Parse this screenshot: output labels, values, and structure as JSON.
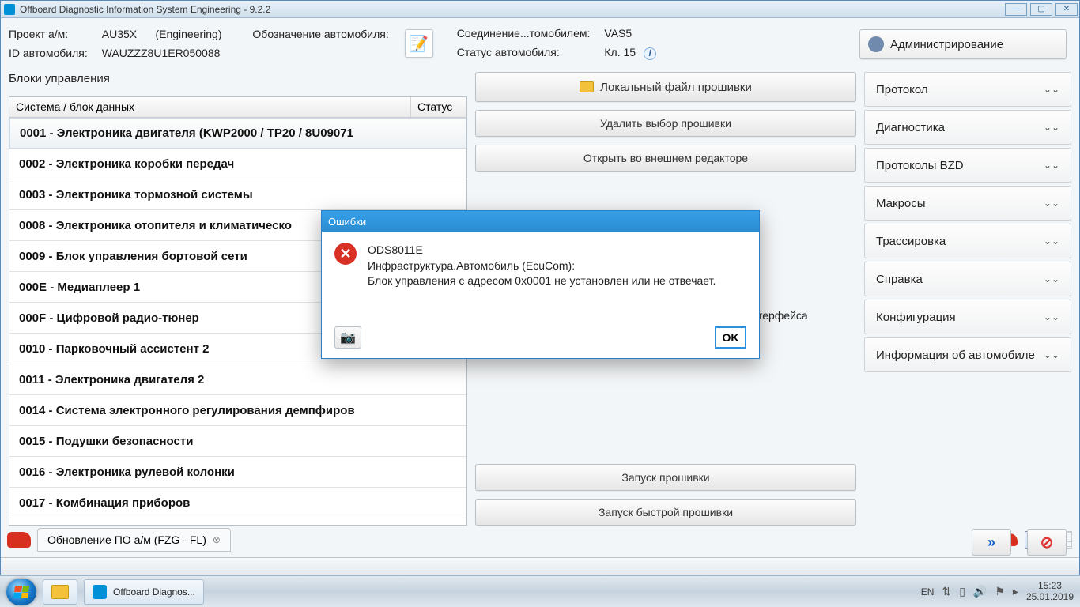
{
  "window": {
    "title": "Offboard Diagnostic Information System Engineering - 9.2.2"
  },
  "header": {
    "project_label": "Проект а/м:",
    "project_value": "AU35X",
    "mode": "(Engineering)",
    "designation_label": "Обозначение автомобиля:",
    "vehicle_id_label": "ID автомобиля:",
    "vehicle_id_value": "WAUZZZ8U1ER050088",
    "connection_label": "Соединение...томобилем:",
    "connection_value": "VAS5",
    "vehicle_status_label": "Статус автомобиля:",
    "vehicle_status_value": "Кл. 15",
    "admin_label": "Администрирование"
  },
  "left": {
    "title": "Блоки управления",
    "col_system": "Система / блок данных",
    "col_status": "Статус",
    "rows": [
      "0001 - Электроника двигателя  (KWP2000 / TP20 / 8U09071",
      "0002 - Электроника коробки передач",
      "0003 - Электроника тормозной системы",
      "0008 - Электроника отопителя и климатическо",
      "0009 - Блок управления бортовой сети",
      "000E - Медиаплеер 1",
      "000F - Цифровой радио-тюнер",
      "0010 - Парковочный ассистент 2",
      "0011 - Электроника двигателя 2",
      "0014 - Система электронного регулирования демпфиров",
      "0015 - Подушки безопасности",
      "0016 - Электроника рулевой колонки",
      "0017 - Комбинация приборов"
    ]
  },
  "mid": {
    "btn_local": "Локальный файл прошивки",
    "btn_delete": "Удалить выбор прошивки",
    "btn_open_ext": "Открыть во внешнем редакторе",
    "cbx_label": "Показать перечень элементов диагностического интерфейса",
    "btn_flash": "Запуск прошивки",
    "btn_fast_flash": "Запуск быстрой прошивки"
  },
  "right": {
    "items": [
      "Протокол",
      "Диагностика",
      "Протоколы BZD",
      "Макросы",
      "Трассировка",
      "Справка",
      "Конфигурация",
      "Информация об автомобиле"
    ]
  },
  "footer": {
    "tab_label": "Обновление ПО а/м (FZG - FL)"
  },
  "modal": {
    "title": "Ошибки",
    "code": "ODS8011E",
    "line2": "Инфраструктура.Автомобиль (EcuCom):",
    "line3": "Блок управления с адресом 0x0001 не установлен или не отвечает.",
    "ok": "OK"
  },
  "taskbar": {
    "app_label": "Offboard Diagnos...",
    "lang": "EN",
    "time": "15:23",
    "date": "25.01.2019"
  }
}
